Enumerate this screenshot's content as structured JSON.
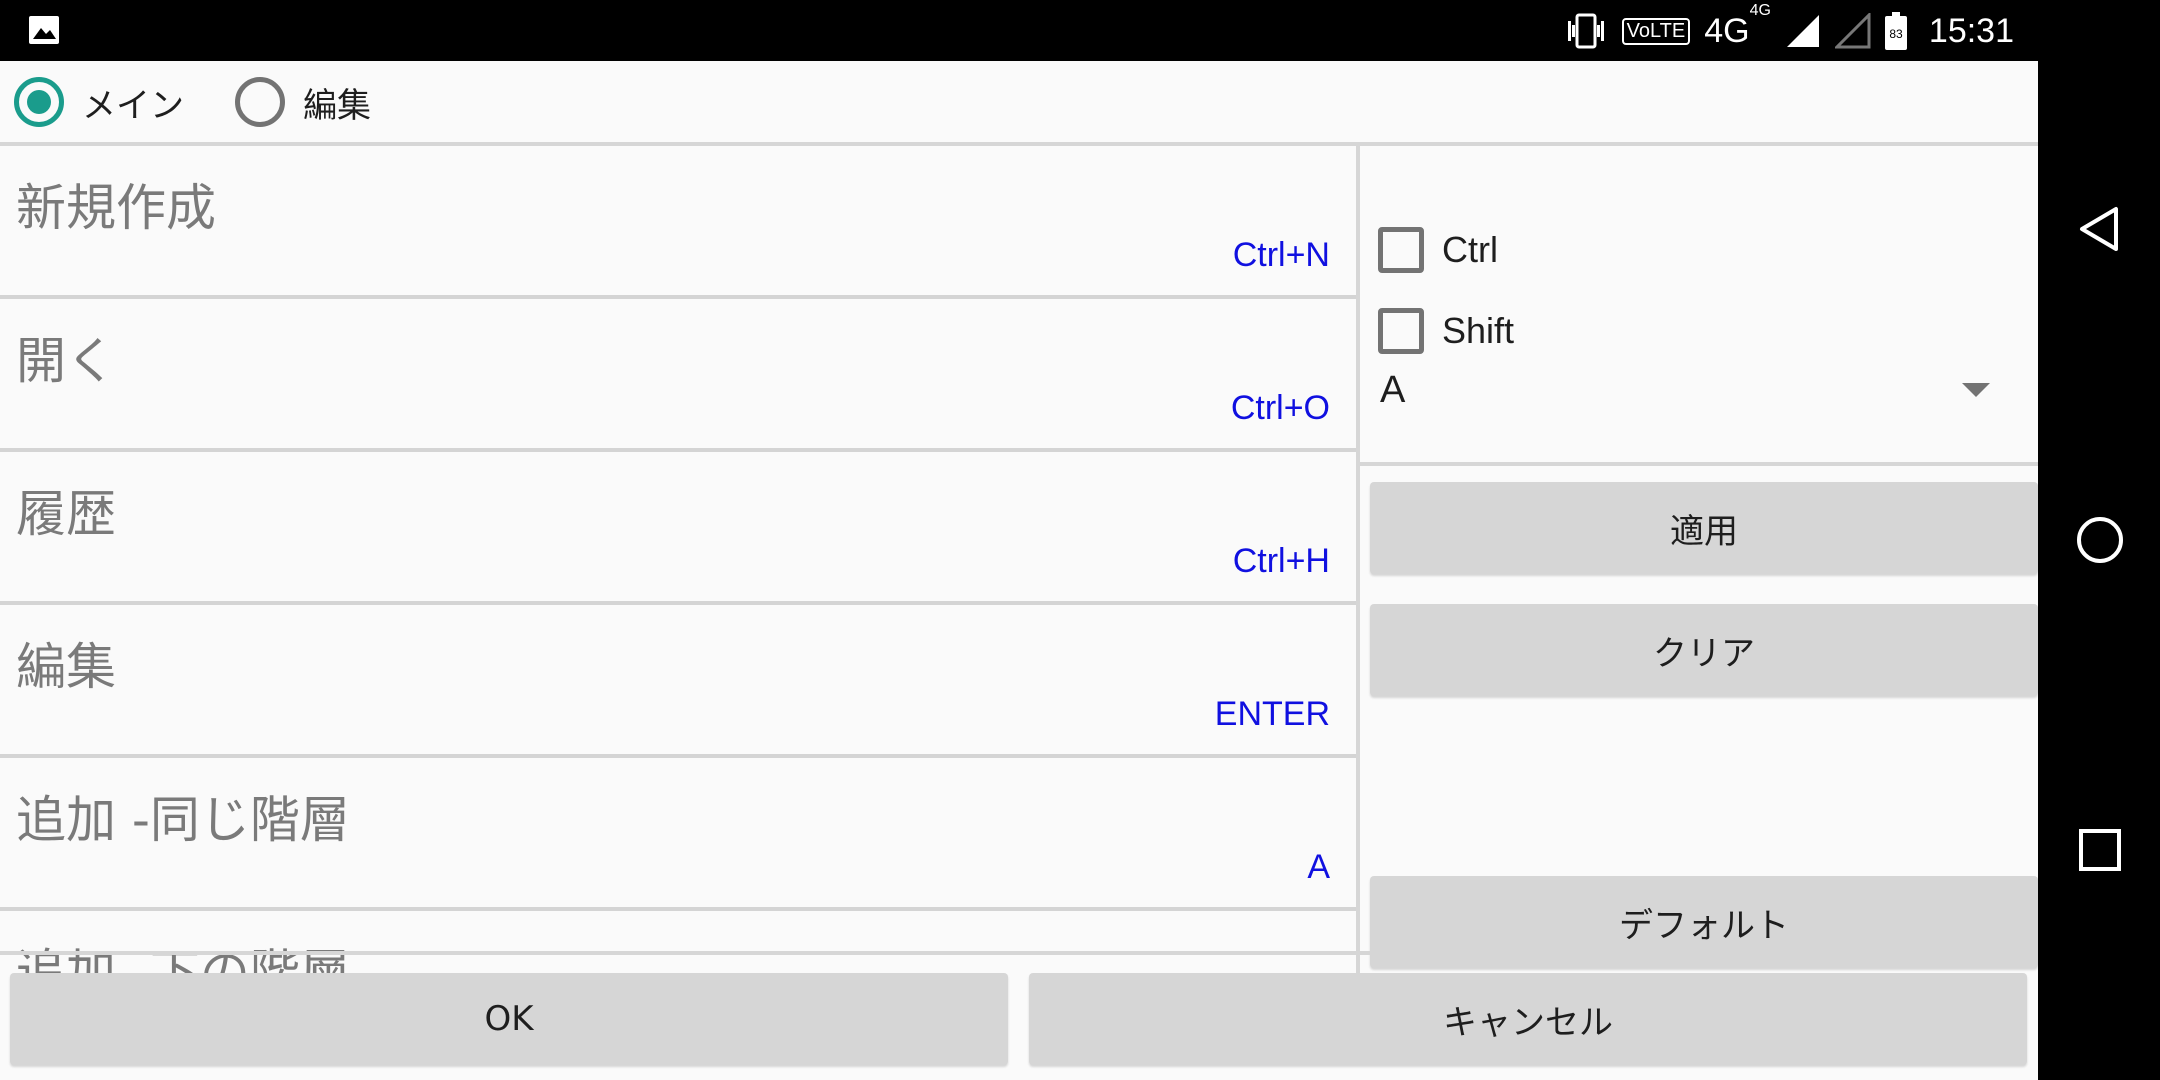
{
  "status_bar": {
    "time": "15:31",
    "volte": "VoLTE",
    "network": "4G",
    "network_sup": "4G",
    "battery": "83",
    "icons": [
      "gallery-icon",
      "vibrate-icon",
      "signal-icon",
      "signal-empty-icon",
      "battery-icon"
    ]
  },
  "mode_radios": [
    {
      "label": "メイン",
      "checked": true
    },
    {
      "label": "編集",
      "checked": false
    }
  ],
  "commands": [
    {
      "name": "新規作成",
      "shortcut": "Ctrl+N"
    },
    {
      "name": "開く",
      "shortcut": "Ctrl+O"
    },
    {
      "name": "履歴",
      "shortcut": "Ctrl+H"
    },
    {
      "name": "編集",
      "shortcut": "ENTER"
    },
    {
      "name": "追加 -同じ階層",
      "shortcut": "A"
    },
    {
      "name": "追加 -下の階層",
      "shortcut": ""
    }
  ],
  "modifiers": {
    "ctrl_label": "Ctrl",
    "ctrl_checked": false,
    "shift_label": "Shift",
    "shift_checked": false
  },
  "key_select": {
    "value": "A"
  },
  "buttons": {
    "apply": "適用",
    "clear": "クリア",
    "default": "デフォルト",
    "ok": "OK",
    "cancel": "キャンセル"
  },
  "colors": {
    "accent": "#1a9c8c",
    "shortcut_text": "#1010e0",
    "command_text": "#7a7a7a",
    "button_bg": "#d6d6d6"
  },
  "nav_bar": {
    "icons": [
      "back-icon",
      "home-icon",
      "recents-icon"
    ]
  }
}
